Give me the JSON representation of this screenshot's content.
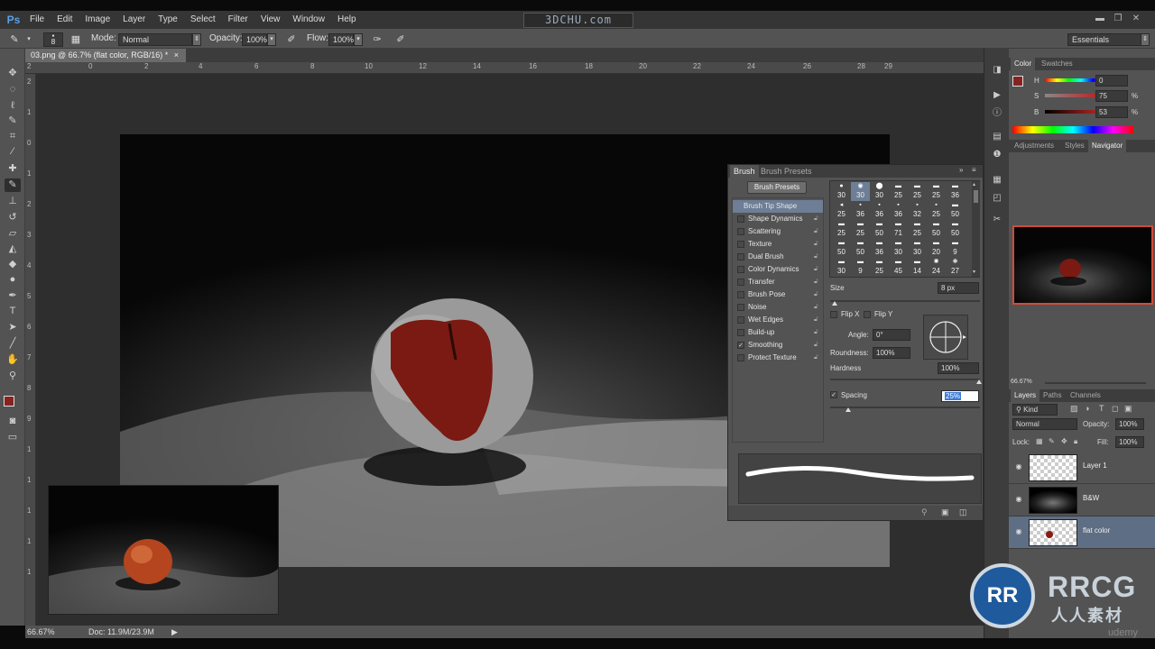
{
  "app": {
    "logo": "Ps",
    "menu": [
      "File",
      "Edit",
      "Image",
      "Layer",
      "Type",
      "Select",
      "Filter",
      "View",
      "Window",
      "Help"
    ],
    "watermark_top": "3DCHU.com",
    "workspace": "Essentials"
  },
  "options_bar": {
    "brush_size": "8",
    "mode_label": "Mode:",
    "mode_value": "Normal",
    "opacity_label": "Opacity:",
    "opacity_value": "100%",
    "flow_label": "Flow:",
    "flow_value": "100%"
  },
  "document": {
    "tab_title": "03.png @ 66.7% (flat color, RGB/16) *",
    "ruler_h": [
      "2",
      "0",
      "2",
      "4",
      "6",
      "8",
      "10",
      "12",
      "14",
      "16",
      "18",
      "20",
      "22",
      "24",
      "26",
      "28",
      "29"
    ],
    "ruler_v": [
      "2",
      "1",
      "0",
      "1",
      "2",
      "3",
      "4",
      "5",
      "6",
      "7",
      "8",
      "9",
      "1",
      "1",
      "1",
      "1",
      "1"
    ]
  },
  "status_bar": {
    "zoom": "66.67%",
    "doc_size": "Doc: 11.9M/23.9M"
  },
  "brush_panel": {
    "tabs": [
      "Brush",
      "Brush Presets"
    ],
    "presets_button": "Brush Presets",
    "list": [
      {
        "label": "Brush Tip Shape",
        "checked": false,
        "active": true
      },
      {
        "label": "Shape Dynamics",
        "checked": false
      },
      {
        "label": "Scattering",
        "checked": false
      },
      {
        "label": "Texture",
        "checked": false
      },
      {
        "label": "Dual Brush",
        "checked": false
      },
      {
        "label": "Color Dynamics",
        "checked": false
      },
      {
        "label": "Transfer",
        "checked": false
      },
      {
        "label": "Brush Pose",
        "checked": false
      },
      {
        "label": "Noise",
        "checked": false
      },
      {
        "label": "Wet Edges",
        "checked": false
      },
      {
        "label": "Build-up",
        "checked": false
      },
      {
        "label": "Smoothing",
        "checked": true
      },
      {
        "label": "Protect Texture",
        "checked": false
      }
    ],
    "tip_sizes": [
      [
        "30",
        "30",
        "30",
        "25",
        "25",
        "25",
        "36"
      ],
      [
        "25",
        "36",
        "36",
        "36",
        "32",
        "25",
        "50"
      ],
      [
        "25",
        "25",
        "50",
        "71",
        "25",
        "50",
        "50"
      ],
      [
        "50",
        "50",
        "36",
        "30",
        "30",
        "20",
        "9"
      ],
      [
        "30",
        "9",
        "25",
        "45",
        "14",
        "24",
        "27"
      ]
    ],
    "size_label": "Size",
    "size_value": "8 px",
    "flip_x": "Flip X",
    "flip_y": "Flip Y",
    "angle_label": "Angle:",
    "angle_value": "0°",
    "roundness_label": "Roundness:",
    "roundness_value": "100%",
    "hardness_label": "Hardness",
    "hardness_value": "100%",
    "spacing_label": "Spacing",
    "spacing_value": "25%"
  },
  "color_panel": {
    "tabs": [
      "Color",
      "Swatches"
    ],
    "h_label": "H",
    "h_value": "0",
    "s_label": "S",
    "s_value": "75",
    "b_label": "B",
    "b_value": "53",
    "percent": "%",
    "foreground": "#872222"
  },
  "adjust_panel": {
    "tabs": [
      "Adjustments",
      "Styles",
      "Navigator"
    ],
    "zoom": "66.67%"
  },
  "layers_panel": {
    "tabs": [
      "Layers",
      "Paths",
      "Channels"
    ],
    "filter": "Kind",
    "blend_mode": "Normal",
    "opacity_label": "Opacity:",
    "opacity_value": "100%",
    "lock_label": "Lock:",
    "fill_label": "Fill:",
    "fill_value": "100%",
    "layers": [
      {
        "name": "Layer 1",
        "active": false
      },
      {
        "name": "B&W",
        "active": false
      },
      {
        "name": "flat color",
        "active": true
      }
    ]
  },
  "watermark": {
    "logo": "RR",
    "brand": "RRCG",
    "sub": "人人素材",
    "udemy": "udemy"
  }
}
